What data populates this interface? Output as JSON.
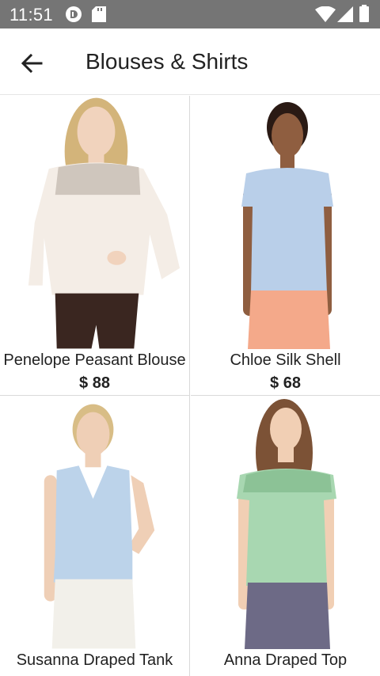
{
  "status_bar": {
    "time": "11:51",
    "icons": [
      "app-circle-icon",
      "sd-card-icon",
      "wifi-icon",
      "signal-icon",
      "battery-icon"
    ]
  },
  "app_bar": {
    "back_icon": "arrow-back-icon",
    "title": "Blouses & Shirts"
  },
  "products": [
    {
      "name": "Penelope Peasant Blouse",
      "price": "$ 88",
      "top_color": "#f4ede6",
      "bottom_color": "#3a2620"
    },
    {
      "name": "Chloe Silk Shell",
      "price": "$ 68",
      "top_color": "#b9cfe9",
      "bottom_color": "#f4a98a"
    },
    {
      "name": "Susanna Draped Tank",
      "price": "",
      "top_color": "#bcd3ea",
      "bottom_color": "#f2f0ea"
    },
    {
      "name": "Anna Draped Top",
      "price": "",
      "top_color": "#a8d7b1",
      "bottom_color": "#6d6a86"
    }
  ]
}
